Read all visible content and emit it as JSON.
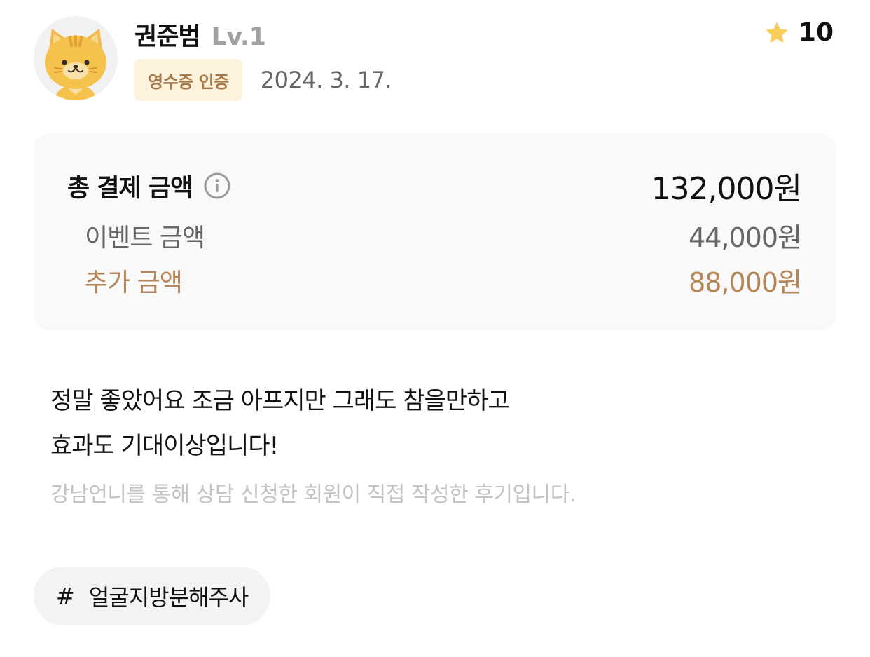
{
  "reviewer": {
    "name": "권준범",
    "level": "Lv.1",
    "avatar_icon": "cat-avatar-icon"
  },
  "badge": {
    "label": "영수증 인증",
    "bg_color": "#fdf3dc",
    "text_color": "#a57a4a"
  },
  "review_date": "2024. 3. 17.",
  "rating": {
    "icon": "star-icon",
    "value": "10",
    "star_color": "#f7cf5a"
  },
  "payment": {
    "total_label": "총 결제 금액",
    "info_icon": "info-icon",
    "total_amount": "132,000원",
    "event_label": "이벤트 금액",
    "event_amount": "44,000원",
    "extra_label": "추가 금액",
    "extra_amount": "88,000원",
    "accent_color": "#b5865a"
  },
  "review": {
    "lines": [
      "정말 좋았어요 조금 아프지만 그래도 참을만하고",
      "효과도 기대이상입니다!"
    ],
    "note": "강남언니를 통해 상담 신청한 회원이 직접 작성한 후기입니다."
  },
  "tag": {
    "hash": "#",
    "label": "얼굴지방분해주사"
  }
}
